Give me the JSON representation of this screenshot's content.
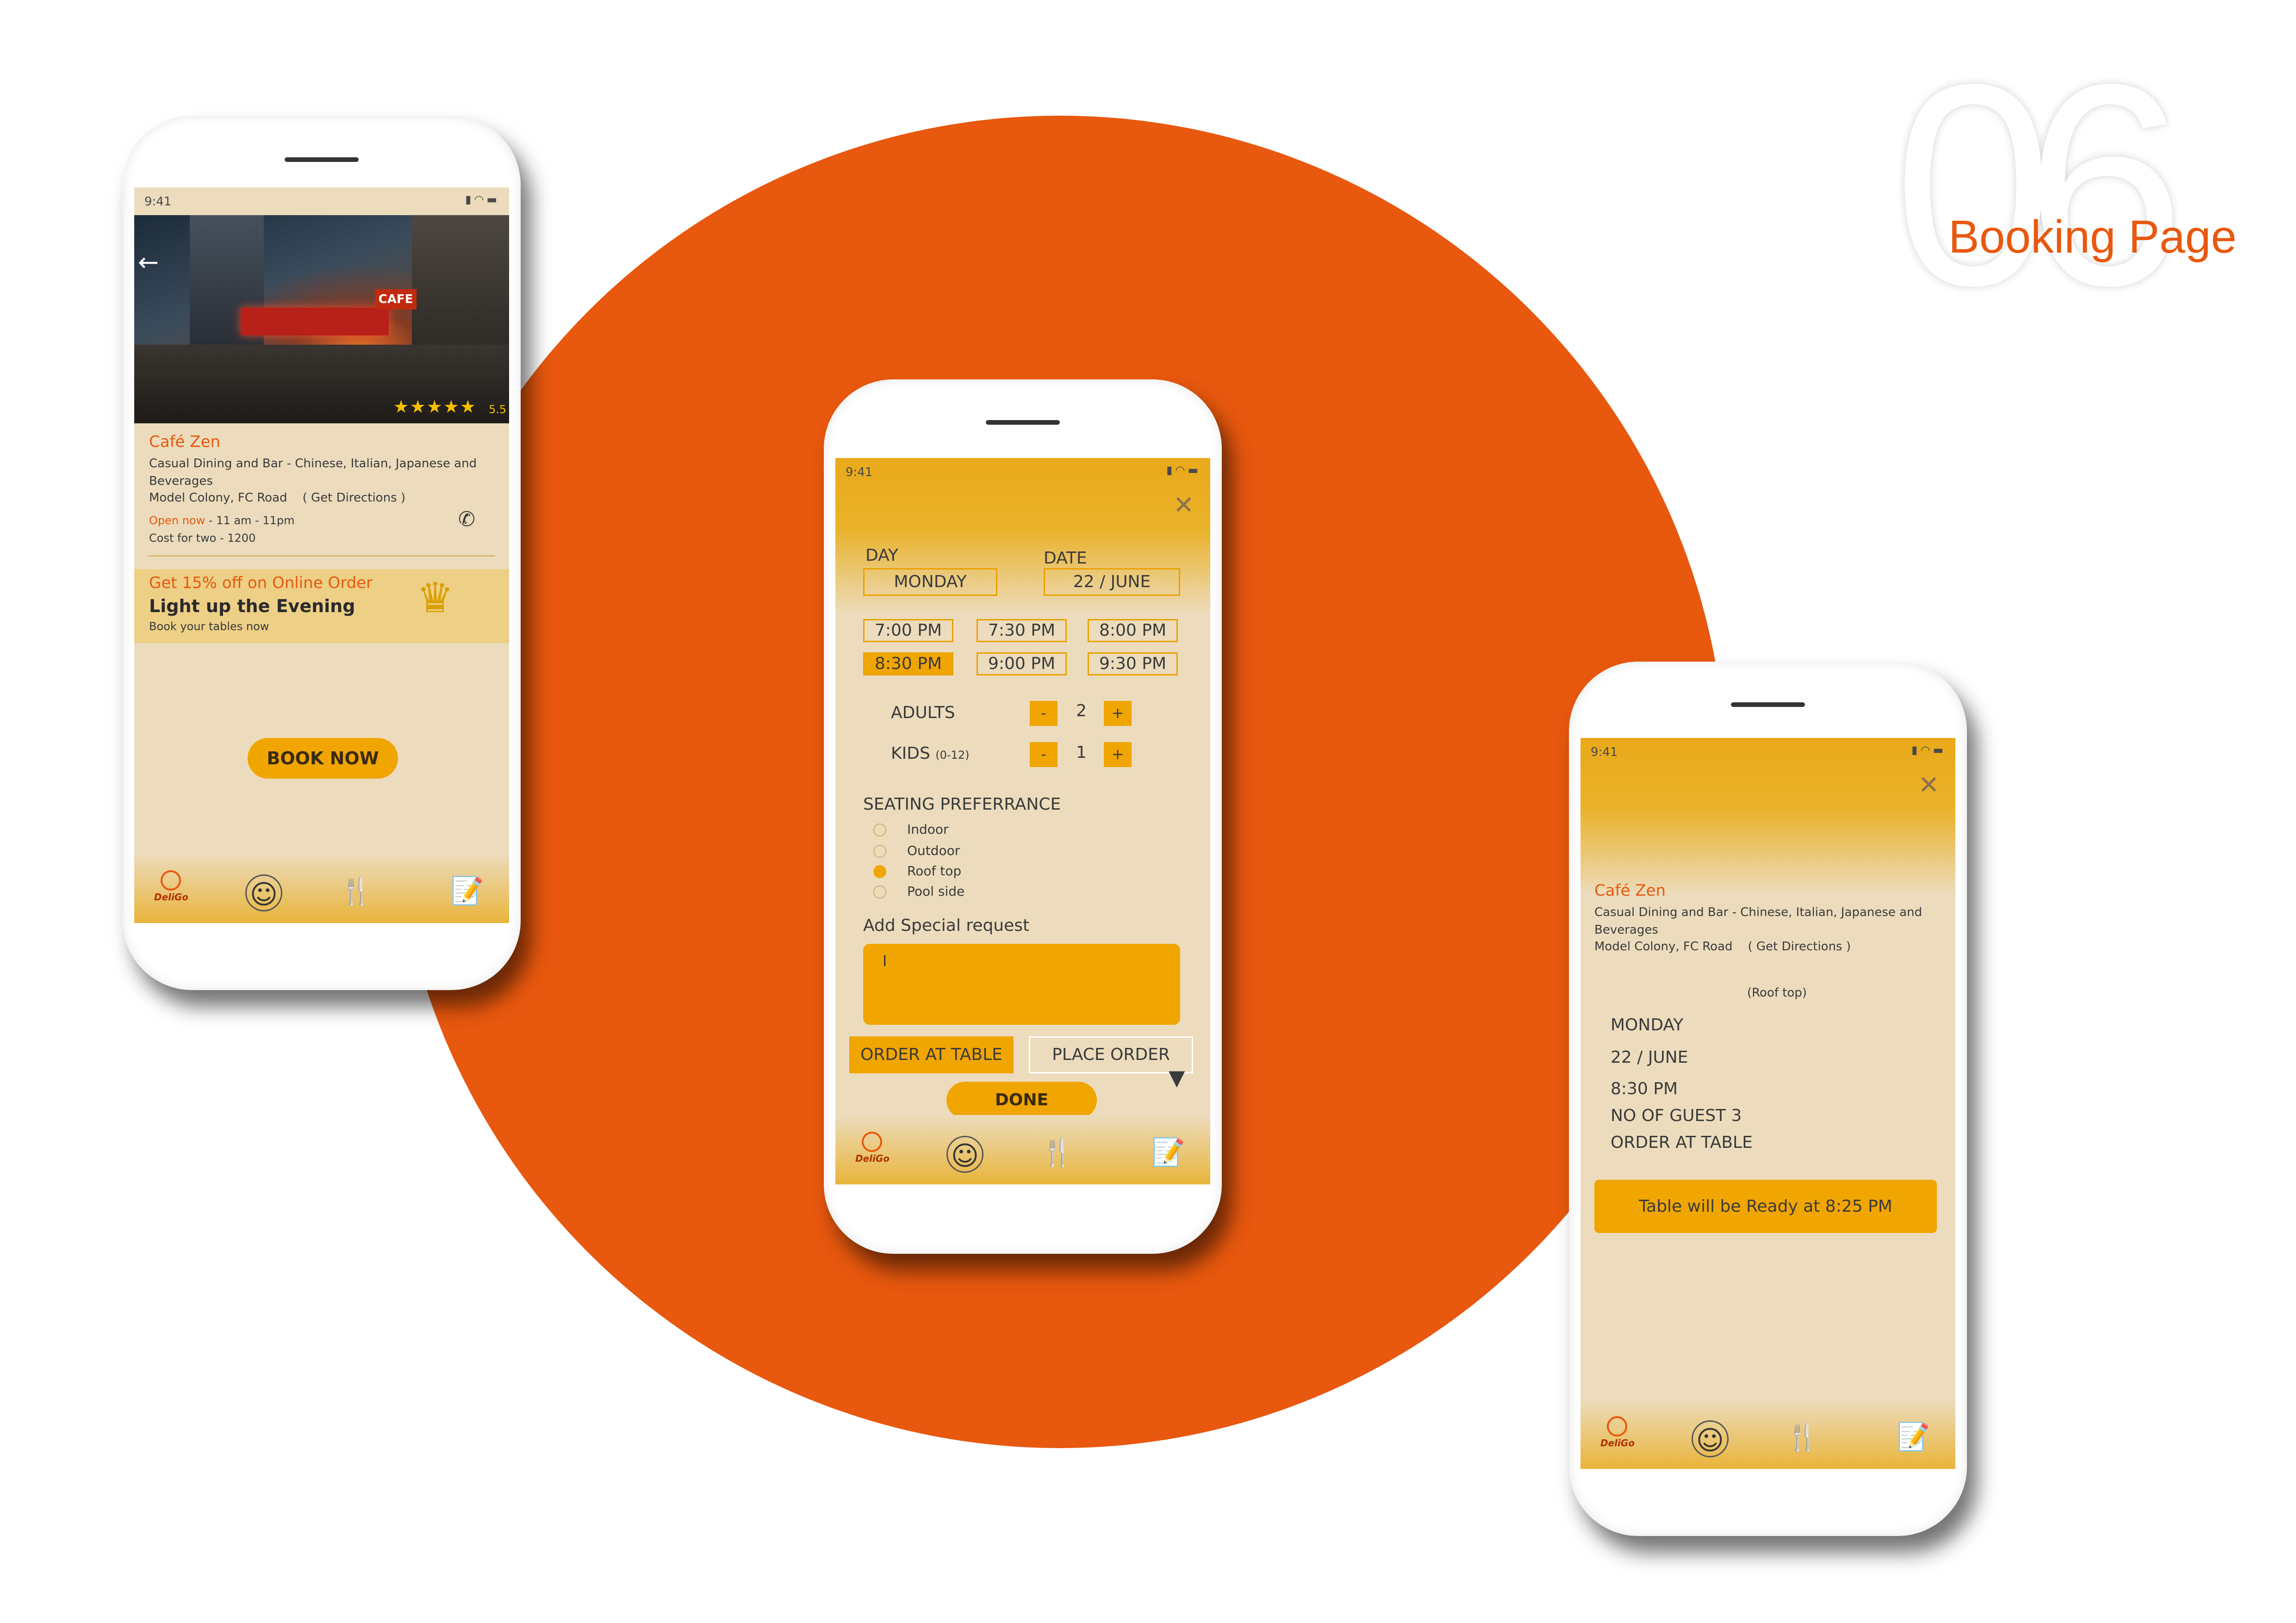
{
  "header": {
    "number": "06",
    "title": "Booking Page"
  },
  "colors": {
    "accent_orange": "#e8580e",
    "accent_amber": "#f0a500",
    "screen_bg": "#ecdcbd"
  },
  "status_bar": {
    "time": "9:41",
    "icons": [
      "signal-icon",
      "wifi-icon",
      "battery-icon"
    ]
  },
  "nav": {
    "logo_text": "DeliGo",
    "items": [
      "home-logo-icon",
      "profile-icon",
      "restaurant-icon",
      "orders-icon"
    ]
  },
  "left_phone": {
    "rating_stars": "★★★★★",
    "rating_value": "5.5",
    "name": "Café Zen",
    "description": "Casual Dining and Bar - Chinese, Italian, Japanese and Beverages",
    "address": "Model Colony, FC Road",
    "directions": "( Get Directions )",
    "open_status": "Open now",
    "hours": " - 11 am - 11pm",
    "cost": "Cost for two - 1200",
    "sign_text": "CAFE",
    "promo": {
      "offer": "Get 15% off on Online Order",
      "headline": "Light up the Evening",
      "sub": "Book your tables now"
    },
    "book_button": "BOOK NOW"
  },
  "middle_phone": {
    "day_label": "DAY",
    "day_value": "MONDAY",
    "date_label": "DATE",
    "date_value": "22 / JUNE",
    "times": [
      "7:00 PM",
      "7:30 PM",
      "8:00 PM",
      "8:30 PM",
      "9:00 PM",
      "9:30 PM"
    ],
    "selected_time": "8:30 PM",
    "adults_label": "ADULTS",
    "adults_value": "2",
    "kids_label": "KIDS",
    "kids_range": "(0-12)",
    "kids_value": "1",
    "minus": "-",
    "plus": "+",
    "seating_title": "SEATING PREFERRANCE",
    "seating_options": [
      "Indoor",
      "Outdoor",
      "Roof top",
      "Pool side"
    ],
    "seating_selected": "Roof top",
    "special_label": "Add Special request",
    "special_value": "I",
    "order_at_table": "ORDER AT TABLE",
    "place_order": "PLACE ORDER",
    "done": "DONE"
  },
  "right_phone": {
    "name": "Café Zen",
    "description": "Casual Dining and Bar - Chinese, Italian, Japanese and Beverages",
    "address": "Model Colony, FC Road",
    "directions": "( Get Directions )",
    "seating": "(Roof top)",
    "day": "MONDAY",
    "date": "22 / JUNE",
    "time": "8:30 PM",
    "guests": "NO OF GUEST 3",
    "order_type": "ORDER AT TABLE",
    "ready_message": "Table will be Ready at 8:25 PM"
  }
}
